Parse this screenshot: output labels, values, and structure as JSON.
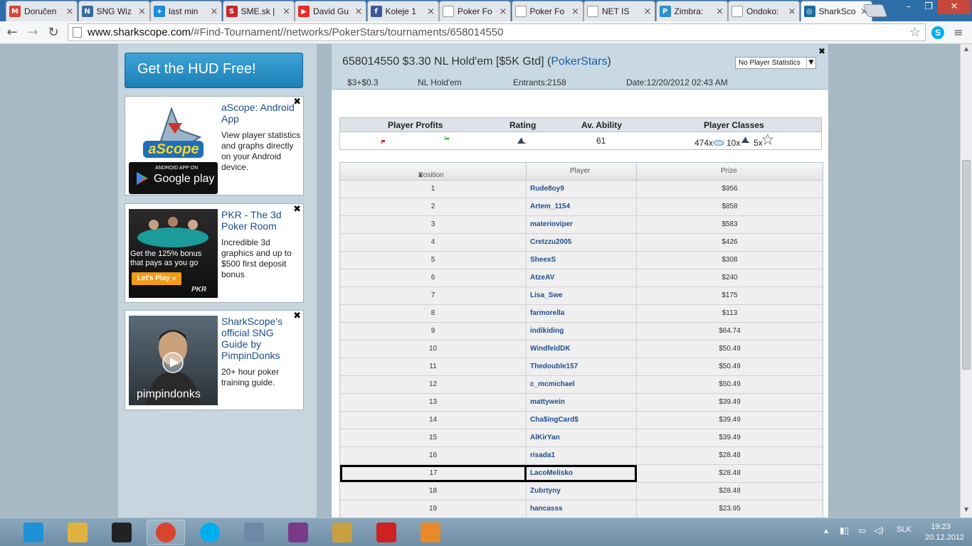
{
  "browser": {
    "tabs": [
      {
        "title": "Doručen",
        "icon": "gmail-icon",
        "color": "#d44638",
        "glyph": "M"
      },
      {
        "title": "SNG Wiz",
        "icon": "sngwiz-icon",
        "color": "#3a6aa0",
        "glyph": "N"
      },
      {
        "title": "last min",
        "icon": "plus-icon",
        "color": "#1f8ad6",
        "glyph": "+"
      },
      {
        "title": "SME.sk |",
        "icon": "sme-icon",
        "color": "#c4262e",
        "glyph": "S"
      },
      {
        "title": "David Gu",
        "icon": "youtube-icon",
        "color": "#e52d27",
        "glyph": "▶"
      },
      {
        "title": "Koleje 1",
        "icon": "facebook-icon",
        "color": "#3b5998",
        "glyph": "f"
      },
      {
        "title": "Poker Fo",
        "icon": "page-icon",
        "color": "#ffffff",
        "glyph": ""
      },
      {
        "title": "Poker Fo",
        "icon": "page-icon",
        "color": "#ffffff",
        "glyph": ""
      },
      {
        "title": "NET IS",
        "icon": "page-icon",
        "color": "#ffffff",
        "glyph": ""
      },
      {
        "title": "Zimbra:",
        "icon": "zimbra-icon",
        "color": "#2f8fd0",
        "glyph": "P"
      },
      {
        "title": "Ondoko:",
        "icon": "page-icon",
        "color": "#ffffff",
        "glyph": ""
      },
      {
        "title": "SharkSco",
        "icon": "sharkscope-icon",
        "color": "#1b6a9c",
        "glyph": "◎"
      }
    ],
    "url_host": "www.sharkscope.com",
    "url_path": "/#Find-Tournament//networks/PokerStars/tournaments/658014550"
  },
  "sidebar": {
    "hud_button": "Get the HUD Free!",
    "ads": [
      {
        "heading": "aScope: Android App",
        "text": "View player statistics and graphs directly on your Android device.",
        "img_logo": "aScope",
        "img_small": "ANDROID APP ON",
        "img_store": "Google play"
      },
      {
        "heading": "PKR - The 3d Poker Room",
        "text": "Incredible 3d graphics and up to $500 first deposit bonus",
        "img_line1": "Get the 125% bonus",
        "img_line2": "that pays as you go",
        "img_btn": "Let's Play »",
        "img_logo": "PKR"
      },
      {
        "heading": "SharkScope's official SNG Guide by PimpinDonks",
        "text": "20+ hour poker training guide.",
        "img_caption": "pimpindonks"
      }
    ]
  },
  "tournament": {
    "title": "658014550 $3.30 NL Hold'em [$5K Gtd] (",
    "network": "PokerStars",
    "title_end": ")",
    "buyin": "$3+$0.3",
    "game": "NL Hold'em",
    "entrants": "Entrants:2158",
    "date": "Date:12/20/2012 02:43 AM",
    "stats_select": "No Player Statistics"
  },
  "summary": {
    "headers": [
      "Player Profits",
      "Rating",
      "Av. Ability",
      "Player Classes"
    ],
    "av_ability": "61",
    "classes": [
      "474x",
      "10x",
      "5x"
    ]
  },
  "results": {
    "columns": [
      "Position",
      "Player",
      "Prize"
    ],
    "rows": [
      {
        "pos": "1",
        "player": "Rude8oy9",
        "prize": "$956"
      },
      {
        "pos": "2",
        "player": "Artem_1154",
        "prize": "$858"
      },
      {
        "pos": "3",
        "player": "materioviper",
        "prize": "$583"
      },
      {
        "pos": "4",
        "player": "Cretzzu2005",
        "prize": "$426"
      },
      {
        "pos": "5",
        "player": "SheexS",
        "prize": "$308"
      },
      {
        "pos": "6",
        "player": "AtzeAV",
        "prize": "$240"
      },
      {
        "pos": "7",
        "player": "Lisa_Swe",
        "prize": "$175"
      },
      {
        "pos": "8",
        "player": "farmorella",
        "prize": "$113"
      },
      {
        "pos": "9",
        "player": "indikiding",
        "prize": "$64.74"
      },
      {
        "pos": "10",
        "player": "WindfeldDK",
        "prize": "$50.49"
      },
      {
        "pos": "11",
        "player": "Thedouble157",
        "prize": "$50.49"
      },
      {
        "pos": "12",
        "player": "c_mcmichael",
        "prize": "$50.49"
      },
      {
        "pos": "13",
        "player": "mattywein",
        "prize": "$39.49"
      },
      {
        "pos": "14",
        "player": "Cha$ingCard$",
        "prize": "$39.49"
      },
      {
        "pos": "15",
        "player": "AlKirYan",
        "prize": "$39.49"
      },
      {
        "pos": "16",
        "player": "risada1",
        "prize": "$28.48"
      },
      {
        "pos": "17",
        "player": "LacoMelisko",
        "prize": "$28.48",
        "highlighted": true
      },
      {
        "pos": "18",
        "player": "Zubrtyny",
        "prize": "$28.48"
      },
      {
        "pos": "19",
        "player": "hancasss",
        "prize": "$23.95"
      }
    ]
  },
  "taskbar": {
    "apps": [
      "internet-explorer-icon",
      "file-explorer-icon",
      "amazon-icon",
      "chrome-icon",
      "skype-icon",
      "documents-icon",
      "winrar-icon",
      "mail-icon",
      "pokerstars-icon",
      "paint-icon"
    ],
    "lang": "SLK",
    "time": "19:23",
    "date": "20.12.2012"
  }
}
